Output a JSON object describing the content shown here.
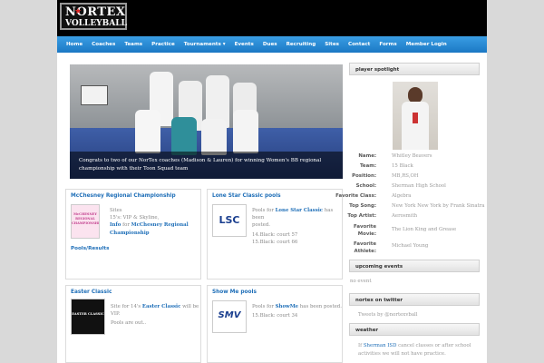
{
  "site": {
    "logo_line1": "NORTEX",
    "logo_line2": "VOLLEYBALL"
  },
  "nav": [
    "Home",
    "Coaches",
    "Teams",
    "Practice",
    "Tournaments ▾",
    "Events",
    "Dues",
    "Recruiting",
    "Sites",
    "Contact",
    "Forms",
    "Member Login"
  ],
  "hero": {
    "caption_line1": "Congrats to two of our NorTex coaches (Madison & Lauren) for winning Women's BB regional",
    "caption_line2": "championship with their Toon Squad team"
  },
  "posts": [
    {
      "title": "McChesney Regional Championship",
      "lines": [
        "Sites",
        "15's: VIP & Skyline,"
      ],
      "info_prefix": "Info",
      "info_rest": " for ",
      "info_link": "McChesney Regional",
      "info_link2": "Championship",
      "footer_link": "Pools/Results",
      "thumb_text": "McCHESNEY REGIONAL CHAMPIONSHIP"
    },
    {
      "title": "Lone Star Classic pools",
      "line1_prefix": "Pools for ",
      "line1_link": "Lone Star Classic",
      "line1_rest": " has been",
      "line2": "posted.",
      "line3": "14.Black: court 57",
      "line4": "15.Black: court 66",
      "thumb_text": "LSC"
    },
    {
      "title": "Easter Classic",
      "line1_prefix": "Site for 14's ",
      "line1_link": "Easter Classic",
      "line1_rest": " will be",
      "line2": "VIP.",
      "line3": "Pools are out..",
      "thumb_text": "EASTER CLASSIC"
    },
    {
      "title": "Show Me pools",
      "line1_prefix": "Pools for ",
      "line1_link": "ShowMe",
      "line1_rest": " has been posted.",
      "line2": "15.Black: court 34",
      "thumb_text": "SMV"
    }
  ],
  "sidebar": {
    "spotlight_title": "player spotlight",
    "profile": [
      {
        "k": "Name:",
        "v": "Whitley Beavers"
      },
      {
        "k": "Team:",
        "v": "15 Black"
      },
      {
        "k": "Position:",
        "v": "MB,RS,OH"
      },
      {
        "k": "School:",
        "v": "Sherman High School"
      },
      {
        "k": "Favorite Class:",
        "v": "Algebra"
      },
      {
        "k": "Top Song:",
        "v": "New York New York by Frank Sinatra"
      },
      {
        "k": "Top Artist:",
        "v": "Aerosmith"
      },
      {
        "k": "Favorite Movie:",
        "v": "The Lion King and Grease"
      },
      {
        "k": "Favorite Athlete:",
        "v": "Michael Young"
      }
    ],
    "upcoming_title": "upcoming events",
    "upcoming_text": "no event",
    "twitter_title": "nortex on twitter",
    "twitter_text": "Tweets by @nortexvball",
    "weather_title": "weather",
    "weather_prefix": "If ",
    "weather_link": "Sherman ISD",
    "weather_rest": " cancel classes or after school",
    "weather_line2": "activities we will not have practice."
  },
  "colors": {
    "nav": "#1b78c4",
    "link": "#1f6fb8"
  }
}
